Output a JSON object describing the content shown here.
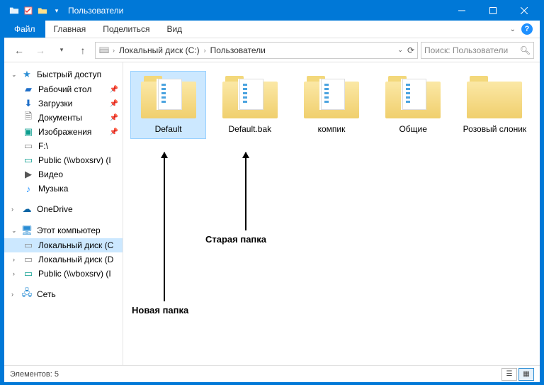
{
  "titlebar": {
    "title": "Пользователи"
  },
  "ribbon": {
    "file": "Файл",
    "home": "Главная",
    "share": "Поделиться",
    "view": "Вид"
  },
  "nav": {
    "crumbs": [
      "Локальный диск (C:)",
      "Пользователи"
    ],
    "search_placeholder": "Поиск: Пользователи"
  },
  "navpane": {
    "quick": {
      "head": "Быстрый доступ",
      "items": [
        {
          "label": "Рабочий стол",
          "pin": true,
          "icon": "desktop"
        },
        {
          "label": "Загрузки",
          "pin": true,
          "icon": "down"
        },
        {
          "label": "Документы",
          "pin": true,
          "icon": "doc"
        },
        {
          "label": "Изображения",
          "pin": true,
          "icon": "img"
        },
        {
          "label": "F:\\",
          "pin": false,
          "icon": "drive"
        },
        {
          "label": "Public (\\\\vboxsrv) (I",
          "pin": false,
          "icon": "net"
        },
        {
          "label": "Видео",
          "pin": false,
          "icon": "vid"
        },
        {
          "label": "Музыка",
          "pin": false,
          "icon": "music"
        }
      ]
    },
    "onedrive": "OneDrive",
    "thispc": {
      "head": "Этот компьютер",
      "items": [
        {
          "label": "Локальный диск (C",
          "sel": true
        },
        {
          "label": "Локальный диск (D"
        },
        {
          "label": "Public (\\\\vboxsrv) (I"
        }
      ]
    },
    "network": "Сеть"
  },
  "folders": [
    {
      "name": "Default",
      "paper": true,
      "sel": true
    },
    {
      "name": "Default.bak",
      "paper": true
    },
    {
      "name": "компик",
      "paper": true
    },
    {
      "name": "Общие",
      "paper": true
    },
    {
      "name": "Розовый слоник",
      "paper": false
    }
  ],
  "annotations": {
    "new": "Новая папка",
    "old": "Старая папка"
  },
  "status": {
    "count_label": "Элементов: 5"
  }
}
